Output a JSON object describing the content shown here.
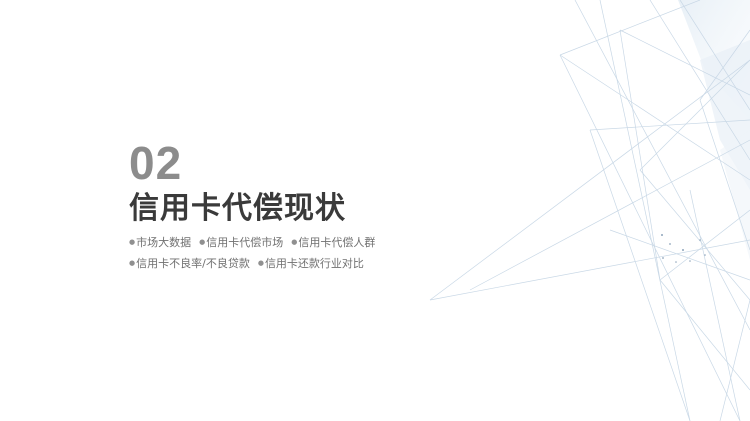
{
  "section": {
    "number": "02",
    "title": "信用卡代偿现状"
  },
  "bullets": {
    "row1": [
      "市场大数据",
      "信用卡代偿市场",
      "信用卡代偿人群"
    ],
    "row2": [
      "信用卡不良率/不良贷款",
      "信用卡还款行业对比"
    ]
  },
  "colors": {
    "number": "#8c8c8c",
    "title": "#3a3a3a",
    "bullet_text": "#707070",
    "decor_lines": "#c9d8e6"
  }
}
